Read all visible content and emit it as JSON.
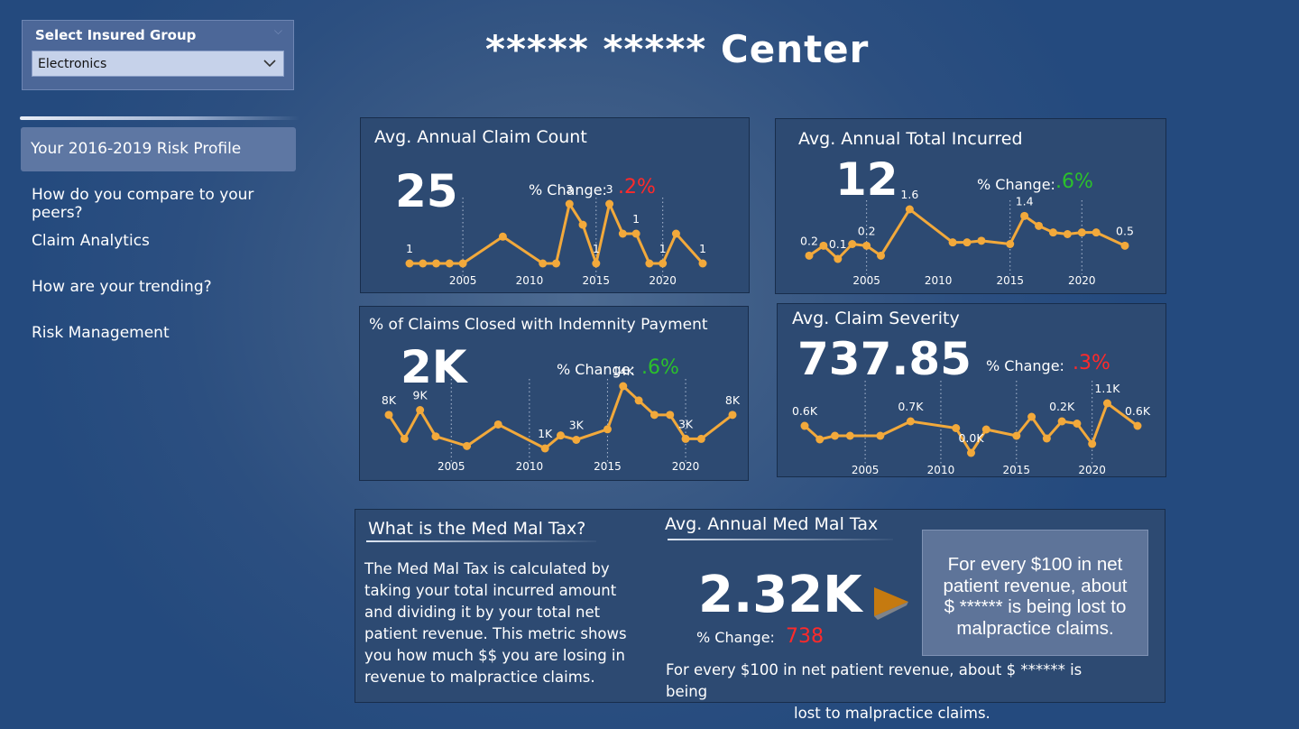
{
  "slicer": {
    "title": "Select Insured Group",
    "value": "Electronics"
  },
  "nav": {
    "items": [
      {
        "label": "Your 2016-2019 Risk Profile",
        "active": true
      },
      {
        "label": "How do you compare to your peers?"
      },
      {
        "label": "Claim Analytics"
      },
      {
        "label": "How are your trending?"
      },
      {
        "label": "Risk Management"
      }
    ]
  },
  "page_title": "***** ***** Center",
  "colors": {
    "line": "#f2a93b",
    "red": "#ff2a2a",
    "green": "#2bc12b",
    "card": "#2d4a72",
    "callout": "#5e7499",
    "arrow": "#c57a10"
  },
  "cards": {
    "claim_count": {
      "title": "Avg. Annual Claim Count",
      "value": "25",
      "pct_label": "% Change:",
      "pct_value": ".2%",
      "pct_color": "red"
    },
    "total_incurred": {
      "title": "Avg. Annual Total Incurred",
      "value": "12",
      "pct_label": "% Change:",
      "pct_value": ".6%",
      "pct_color": "green"
    },
    "closed_indemnity": {
      "title": "% of Claims Closed with Indemnity Payment",
      "value": "2K",
      "pct_label": "% Change:",
      "pct_value": ".6%",
      "pct_color": "green"
    },
    "claim_severity": {
      "title": "Avg. Claim Severity",
      "value": "737.85",
      "pct_label": "% Change:",
      "pct_value": ".3%",
      "pct_color": "red"
    }
  },
  "med_mal": {
    "info_title": "What is the Med Mal Tax?",
    "info_lines": [
      "The Med Mal Tax is calculated by",
      "taking your total incurred amount",
      "and dividing it by your total net",
      "patient revenue.  This metric shows",
      "you how much $$ you are losing in",
      "revenue to malpractice claims."
    ],
    "kpi_title": "Avg. Annual Med Mal Tax",
    "kpi_value": "2.32K",
    "pct_label": "% Change:",
    "pct_value": "738",
    "note_line1": "For every $100 in net patient revenue, about $ ****** is being",
    "note_line2": "lost to malpractice claims.",
    "callout_lines": [
      "For every $100 in net",
      "patient revenue, about",
      "$ ****** is being lost to",
      "malpractice claims."
    ],
    "arrow_icon": "play-arrow-icon"
  },
  "chart_data": [
    {
      "type": "line",
      "name": "claim_count",
      "x": [
        2001,
        2002,
        2003,
        2004,
        2005,
        2008,
        2011,
        2012,
        2013,
        2014,
        2015,
        2016,
        2017,
        2018,
        2019,
        2020,
        2021,
        2023
      ],
      "y": [
        1,
        1,
        1,
        1,
        1,
        1.9,
        1,
        1,
        3,
        2.3,
        1,
        3,
        2,
        2,
        1,
        1,
        2,
        1
      ],
      "data_labels": [
        {
          "x": 2001,
          "text": "1"
        },
        {
          "x": 2013,
          "text": "3"
        },
        {
          "x": 2015,
          "text": "1"
        },
        {
          "x": 2016,
          "text": "3"
        },
        {
          "x": 2018,
          "text": "1"
        },
        {
          "x": 2020,
          "text": "1"
        },
        {
          "x": 2023,
          "text": "1"
        }
      ],
      "x_ticks": [
        2005,
        2010,
        2015,
        2020
      ],
      "ylim": [
        1,
        3
      ]
    },
    {
      "type": "line",
      "name": "total_incurred",
      "x": [
        2001,
        2002,
        2003,
        2004,
        2005,
        2006,
        2008,
        2011,
        2012,
        2013,
        2015,
        2016,
        2017,
        2018,
        2019,
        2020,
        2021,
        2023
      ],
      "y": [
        0.2,
        0.5,
        0.1,
        0.55,
        0.5,
        0.2,
        1.6,
        0.6,
        0.6,
        0.65,
        0.55,
        1.4,
        1.1,
        0.9,
        0.85,
        0.9,
        0.9,
        0.5
      ],
      "data_labels": [
        {
          "x": 2001,
          "text": "0.2"
        },
        {
          "x": 2003,
          "text": "0.1"
        },
        {
          "x": 2005,
          "text": "0.2"
        },
        {
          "x": 2008,
          "text": "1.6"
        },
        {
          "x": 2016,
          "text": "1.4"
        },
        {
          "x": 2023,
          "text": "0.5"
        }
      ],
      "x_ticks": [
        2005,
        2010,
        2015,
        2020
      ],
      "ylim": [
        0.1,
        1.6
      ]
    },
    {
      "type": "line",
      "name": "closed_indemnity",
      "x": [
        2001,
        2002,
        2003,
        2004,
        2006,
        2008,
        2011,
        2012,
        2013,
        2015,
        2016,
        2017,
        2018,
        2019,
        2020,
        2021,
        2023
      ],
      "y": [
        8,
        3,
        9,
        3.5,
        1.5,
        6,
        1,
        3.7,
        2.8,
        5,
        14,
        11,
        8,
        8,
        3,
        3,
        8
      ],
      "data_labels": [
        {
          "x": 2001,
          "text": "8K"
        },
        {
          "x": 2003,
          "text": "9K"
        },
        {
          "x": 2011,
          "text": "1K"
        },
        {
          "x": 2013,
          "text": "3K"
        },
        {
          "x": 2016,
          "text": "14K"
        },
        {
          "x": 2020,
          "text": "3K"
        },
        {
          "x": 2023,
          "text": "8K"
        }
      ],
      "x_ticks": [
        2005,
        2010,
        2015,
        2020
      ],
      "ylim": [
        1,
        14
      ]
    },
    {
      "type": "line",
      "name": "claim_severity",
      "x": [
        2001,
        2002,
        2003,
        2004,
        2006,
        2008,
        2011,
        2012,
        2013,
        2015,
        2016,
        2017,
        2018,
        2019,
        2020,
        2021,
        2023
      ],
      "y": [
        0.6,
        0.3,
        0.38,
        0.38,
        0.38,
        0.7,
        0.55,
        0.0,
        0.52,
        0.38,
        0.8,
        0.32,
        0.7,
        0.65,
        0.2,
        1.1,
        0.6
      ],
      "data_labels": [
        {
          "x": 2001,
          "text": "0.6K"
        },
        {
          "x": 2008,
          "text": "0.7K"
        },
        {
          "x": 2012,
          "text": "0.0K"
        },
        {
          "x": 2018,
          "text": "0.2K"
        },
        {
          "x": 2021,
          "text": "1.1K"
        },
        {
          "x": 2023,
          "text": "0.6K"
        }
      ],
      "x_ticks": [
        2005,
        2010,
        2015,
        2020
      ],
      "ylim": [
        0,
        1.1
      ]
    }
  ]
}
